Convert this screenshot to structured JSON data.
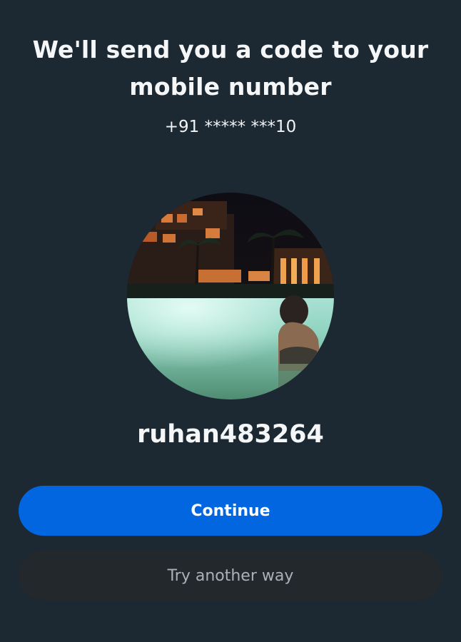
{
  "heading": {
    "line1": "We'll send you a code to your",
    "line2": "mobile number"
  },
  "phone_masked": "+91 ***** ***10",
  "profile": {
    "photo": "profile-photo",
    "username": "ruhan483264"
  },
  "actions": {
    "continue_label": "Continue",
    "try_another_label": "Try another way"
  },
  "colors": {
    "background": "#1c2933",
    "primary_button": "#0266e1",
    "secondary_button": "#23282d",
    "secondary_text": "#a9b1b9"
  }
}
